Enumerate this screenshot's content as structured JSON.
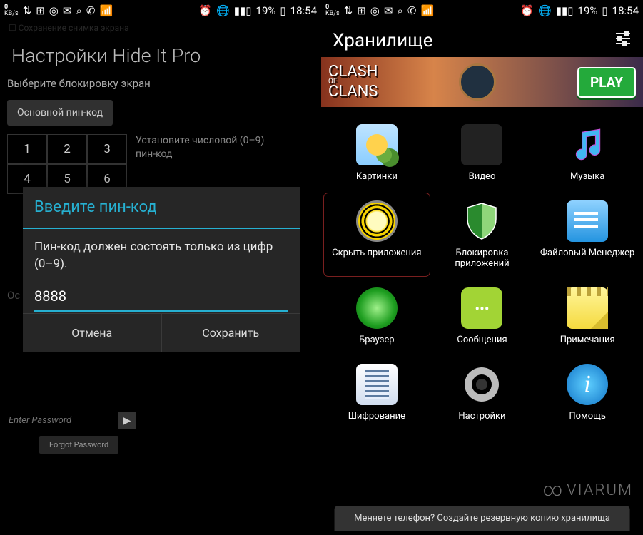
{
  "status": {
    "kbs": "0",
    "kbunit": "KB/s",
    "icons": [
      "⇅",
      "⊞",
      "◎",
      "✉",
      "⌕",
      "☏",
      "⫽"
    ],
    "ricons": [
      "⏰",
      "📶",
      "▮▮▯",
      "19%",
      "▊"
    ],
    "time": "18:54"
  },
  "left": {
    "save_hint": "Сохранение снимка экрана",
    "title": "Настройки Hide It Pro",
    "subtitle": "Выберите блокировку экран",
    "tab": "Основной пин-код",
    "keys": [
      "1",
      "2",
      "3",
      "4",
      "5",
      "6"
    ],
    "help": "Установите числовой (0–9) пин-код",
    "modal": {
      "title": "Введите пин-код",
      "body": "Пин-код должен состоять только из цифр (0–9).",
      "value": "8888",
      "cancel": "Отмена",
      "save": "Сохранить"
    },
    "pw_placeholder": "Enter Password",
    "forgot": "Forgot Password",
    "ост": "Ос"
  },
  "right": {
    "title": "Хранилище",
    "ad": {
      "logo_top": "CLASH",
      "logo_mid": "OF",
      "logo_bot": "CLANS",
      "cta": "PLAY"
    },
    "items": [
      {
        "label": "Картинки"
      },
      {
        "label": "Видео"
      },
      {
        "label": "Музыка"
      },
      {
        "label": "Скрыть приложения",
        "hi": true
      },
      {
        "label": "Блокировка приложений"
      },
      {
        "label": "Файловый Менеджер"
      },
      {
        "label": "Браузер"
      },
      {
        "label": "Сообщения"
      },
      {
        "label": "Примечания"
      },
      {
        "label": "Шифрование"
      },
      {
        "label": "Настройки"
      },
      {
        "label": "Помощь"
      }
    ],
    "backup": "Меняете телефон? Создайте резервную копию хранилища"
  },
  "watermark": "VIARUM"
}
